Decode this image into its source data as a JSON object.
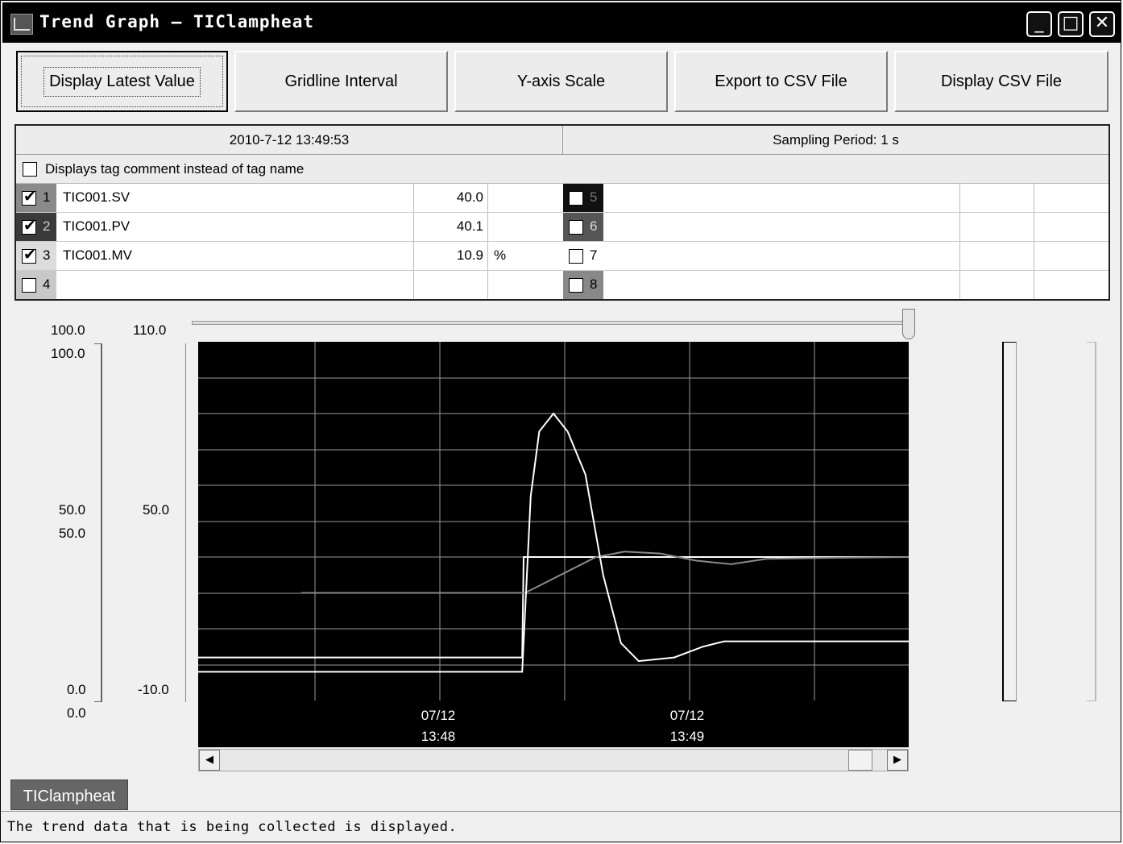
{
  "window": {
    "title": "Trend Graph – TIClampheat",
    "minimize_glyph": "_",
    "maximize_glyph": "□",
    "close_glyph": "✕"
  },
  "toolbar": {
    "display_latest_value": "Display Latest Value",
    "gridline_interval": "Gridline Interval",
    "y_axis_scale": "Y-axis Scale",
    "export_csv": "Export to CSV File",
    "display_csv": "Display CSV File"
  },
  "tags": {
    "timestamp": "2010-7-12 13:49:53",
    "sampling_period": "Sampling Period: 1 s",
    "comment_toggle_label": "Displays tag comment instead of tag name",
    "left": [
      {
        "num": "1",
        "name": "TIC001.SV",
        "value": "40.0",
        "unit": "",
        "checked": true
      },
      {
        "num": "2",
        "name": "TIC001.PV",
        "value": "40.1",
        "unit": "",
        "checked": true
      },
      {
        "num": "3",
        "name": "TIC001.MV",
        "value": "10.9",
        "unit": "%",
        "checked": true
      },
      {
        "num": "4",
        "name": "",
        "value": "",
        "unit": "",
        "checked": false
      }
    ],
    "right": [
      {
        "num": "5",
        "checked": false
      },
      {
        "num": "6",
        "checked": false
      },
      {
        "num": "7",
        "checked": false
      },
      {
        "num": "8",
        "checked": false
      }
    ]
  },
  "chart": {
    "axis_a_top": "100.0",
    "axis_a_top2": "100.0",
    "axis_a_mid": "50.0",
    "axis_a_mid2": "50.0",
    "axis_a_bottom": "0.0",
    "axis_a_bottom2": "0.0",
    "axis_b_top": "110.0",
    "axis_b_mid": "50.0",
    "axis_b_bottom": "-10.0",
    "time_labels": [
      {
        "date": "07/12",
        "time": "13:48"
      },
      {
        "date": "07/12",
        "time": "13:49"
      }
    ]
  },
  "chart_data": {
    "type": "line",
    "y_axes": [
      {
        "name": "left-axis-1",
        "ylim": [
          0,
          100
        ]
      },
      {
        "name": "left-axis-2",
        "ylim": [
          -10,
          110
        ]
      }
    ],
    "x_tick_labels": [
      "07/12 13:48",
      "07/12 13:49"
    ],
    "series": [
      {
        "name": "TIC001.SV",
        "color": "#ffffff",
        "points": [
          [
            0.0,
            12
          ],
          [
            0.456,
            12
          ],
          [
            0.458,
            40
          ],
          [
            1.0,
            40
          ]
        ]
      },
      {
        "name": "TIC001.PV",
        "color": "#8a8a8a",
        "points": [
          [
            0.145,
            30
          ],
          [
            0.3,
            30
          ],
          [
            0.46,
            30
          ],
          [
            0.48,
            32
          ],
          [
            0.52,
            36
          ],
          [
            0.56,
            40
          ],
          [
            0.6,
            41.5
          ],
          [
            0.65,
            41
          ],
          [
            0.7,
            39
          ],
          [
            0.75,
            38
          ],
          [
            0.8,
            39.5
          ],
          [
            0.9,
            39.8
          ],
          [
            1.0,
            40
          ]
        ]
      },
      {
        "name": "TIC001.MV",
        "color": "#ffffff",
        "points": [
          [
            0.0,
            8
          ],
          [
            0.456,
            8
          ],
          [
            0.468,
            57
          ],
          [
            0.48,
            75
          ],
          [
            0.5,
            80
          ],
          [
            0.52,
            75
          ],
          [
            0.545,
            63
          ],
          [
            0.57,
            35
          ],
          [
            0.595,
            16
          ],
          [
            0.62,
            11
          ],
          [
            0.67,
            12
          ],
          [
            0.71,
            15
          ],
          [
            0.74,
            16.5
          ],
          [
            1.0,
            16.5
          ]
        ]
      }
    ]
  },
  "tab": {
    "label": "TIClampheat"
  },
  "status": {
    "text": "The trend data that is being collected is displayed."
  }
}
